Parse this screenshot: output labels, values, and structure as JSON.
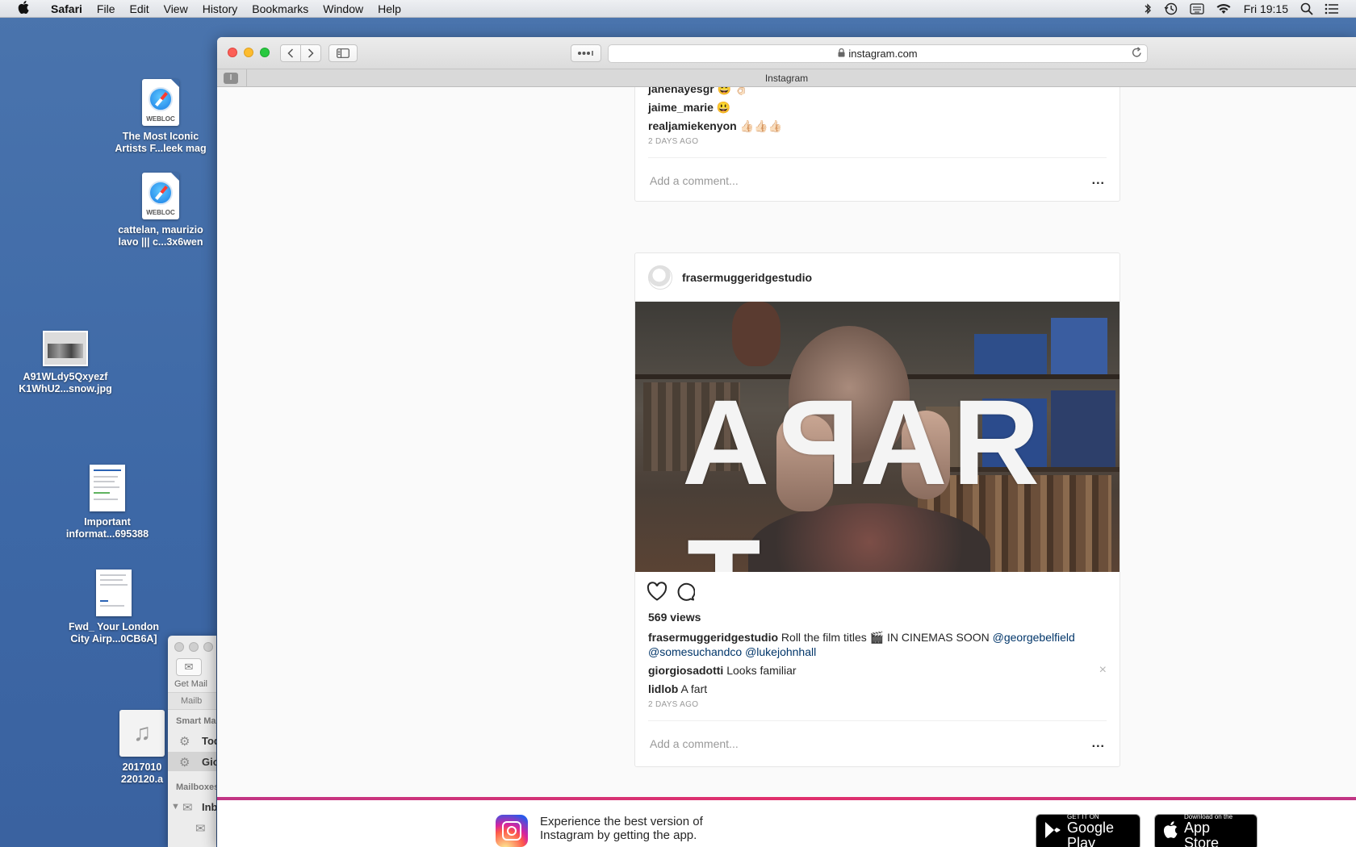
{
  "menubar": {
    "apple": "",
    "items": [
      "Safari",
      "File",
      "Edit",
      "View",
      "History",
      "Bookmarks",
      "Window",
      "Help"
    ],
    "clock": "Fri 19:15",
    "status_icons": [
      "bluetooth-icon",
      "time-machine-icon",
      "keyboard-input-icon",
      "wifi-icon",
      "spotlight-search-icon",
      "notification-center-icon"
    ]
  },
  "desktop": {
    "icons": [
      {
        "label": "The Most Iconic\nArtists F...leek mag",
        "kind": "webloc",
        "badge": "WEBLOC"
      },
      {
        "label": "cattelan, maurizio\nlavo ||| c...3x6wen",
        "kind": "webloc",
        "badge": "WEBLOC"
      },
      {
        "label": "A91WLdy5Qxyezf\nK1WhU2...snow.jpg",
        "kind": "photo"
      },
      {
        "label": "Important\ninformat...695388",
        "kind": "document"
      },
      {
        "label": "Fwd_ Your London\nCity Airp...0CB6A]",
        "kind": "document"
      },
      {
        "label": "2017010\n220120.a",
        "kind": "audio"
      }
    ]
  },
  "mail": {
    "get_mail": "Get Mail",
    "mailboxes_bar": "Mailb",
    "smart_mailboxes": "Smart Ma",
    "rows": [
      "Tod",
      "Gio"
    ],
    "mailboxes_section": "Mailboxes",
    "inbox": "Inb"
  },
  "safari": {
    "url": "instagram.com",
    "tab_title": "Instagram",
    "pinned_tab": "I"
  },
  "post1": {
    "comments": [
      {
        "user": "janehayesgr",
        "text": "😄 👌🏻"
      },
      {
        "user": "jaime_marie",
        "text": "😃"
      },
      {
        "user": "realjamiekenyon",
        "text": "👍🏻👍🏻👍🏻"
      }
    ],
    "time": "2 DAYS AGO",
    "add_comment_placeholder": "Add a comment...",
    "more": "..."
  },
  "post2": {
    "username": "frasermuggeridgestudio",
    "image_text": [
      "A",
      "P",
      "A",
      "R",
      "T"
    ],
    "views": "569 views",
    "caption": {
      "user": "frasermuggeridgestudio",
      "text": "Roll the film titles 🎬 IN CINEMAS SOON",
      "mentions": [
        "@georgebelfield",
        "@somesuchandco",
        "@lukejohnhall"
      ]
    },
    "comments": [
      {
        "user": "giorgiosadotti",
        "text": "Looks familiar"
      },
      {
        "user": "lidlob",
        "text": "A fart"
      }
    ],
    "close": "×",
    "time": "2 DAYS AGO",
    "add_comment_placeholder": "Add a comment...",
    "more": "..."
  },
  "app_banner": {
    "promo_line1": "Experience the best version of",
    "promo_line2": "Instagram by getting the app.",
    "google_small": "GET IT ON",
    "google_big": "Google Play",
    "apple_small": "Download on the",
    "apple_big": "App Store"
  },
  "colors": {
    "desktop": "#3f6aa5",
    "link": "#003569",
    "banner_gradient": [
      "#c13584",
      "#e1306c"
    ]
  }
}
